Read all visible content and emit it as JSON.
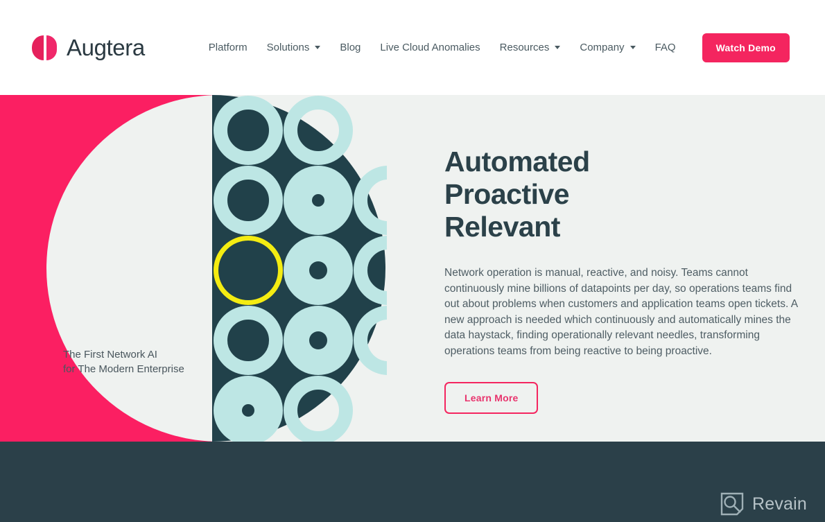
{
  "header": {
    "brand_name": "Augtera",
    "logo_icon": "augtera-split-circle-logo",
    "nav": [
      {
        "label": "Platform",
        "has_caret": false
      },
      {
        "label": "Solutions",
        "has_caret": true
      },
      {
        "label": "Blog",
        "has_caret": false
      },
      {
        "label": "Live Cloud Anomalies",
        "has_caret": false
      },
      {
        "label": "Resources",
        "has_caret": true
      },
      {
        "label": "Company",
        "has_caret": true
      },
      {
        "label": "FAQ",
        "has_caret": false
      }
    ],
    "cta_label": "Watch Demo"
  },
  "hero": {
    "tagline_line1": "The First Network AI",
    "tagline_line2": "for The Modern Enterprise",
    "headline_line1": "Automated",
    "headline_line2": "Proactive",
    "headline_line3": "Relevant",
    "body": "Network operation is manual, reactive, and noisy. Teams cannot continuously mine billions of datapoints per day, so operations teams find out about problems when customers and application teams open tickets. A new approach is needed which continuously and automatically mines the data haystack, finding operationally relevant needles, transforming operations teams from being reactive to being proactive.",
    "learn_more_label": "Learn More"
  },
  "footer": {
    "watermark_label": "Revain",
    "watermark_icon": "revain-magnifier-icon"
  },
  "colors": {
    "brand_pink": "#fb1f62",
    "cta_pink": "#f4255f",
    "dark_teal": "#2b4049",
    "disc_teal": "#21414a",
    "ring_cyan": "#bde6e4",
    "accent_yellow": "#f4ec12",
    "hero_bg": "#eff2f0",
    "text_dark": "#2b4149",
    "text_body": "#4e5d64"
  }
}
